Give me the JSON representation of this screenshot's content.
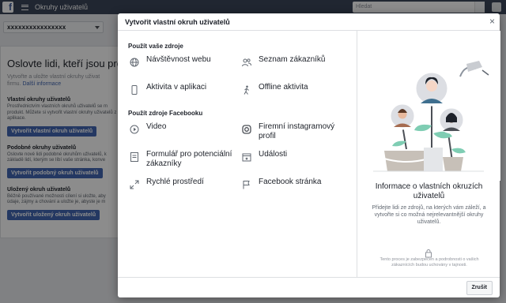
{
  "topbar": {
    "title": "Okruhy uživatelů",
    "search_placeholder": "Hledat"
  },
  "account": {
    "name": "xxxxxxxxxxxxxxxx"
  },
  "background": {
    "heading": "Oslovte lidi, kteří jsou pro vá",
    "intro_line1": "Vytvořte a uložte vlastní okruhy uživat",
    "intro_line2": "firmu.",
    "intro_link": "Další informace",
    "sections": [
      {
        "title": "Vlastní okruhy uživatelů",
        "lines": [
          "Prostřednictvím vlastních okruhů uživatelů se m",
          "produkt. Můžete si vytvořit vlastní okruhy uživatelů z",
          "aplikace."
        ],
        "button": "Vytvořit vlastní okruh uživatelů"
      },
      {
        "title": "Podobné okruhy uživatelů",
        "lines": [
          "Oslovte nové lidi podobné okruhům uživatelů, k",
          "základě lidí, kterým se líbí vaše stránka, konve"
        ],
        "button": "Vytvořit podobný okruh uživatelů"
      },
      {
        "title": "Uložený okruh uživatelů",
        "lines": [
          "Běžně používané možnosti cílení si uložte, aby",
          "údaje, zájmy a chování a uložte je, abyste je m"
        ],
        "button": "Vytvořit uložený okruh uživatelů"
      }
    ]
  },
  "modal": {
    "title": "Vytvořit vlastní okruh uživatelů",
    "close_label": "×",
    "group1_title": "Použít vaše zdroje",
    "group1": [
      {
        "label": "Návštěvnost webu",
        "icon": "globe-icon"
      },
      {
        "label": "Seznam zákazníků",
        "icon": "people-icon"
      },
      {
        "label": "Aktivita v aplikaci",
        "icon": "mobile-icon"
      },
      {
        "label": "Offline aktivita",
        "icon": "person-walking-icon"
      }
    ],
    "group2_title": "Použít zdroje Facebooku",
    "group2": [
      {
        "label": "Video",
        "icon": "play-icon"
      },
      {
        "label": "Firemní instagramový profil",
        "icon": "instagram-icon"
      },
      {
        "label": "Formulář pro potenciální zákazníky",
        "icon": "form-icon"
      },
      {
        "label": "Události",
        "icon": "calendar-icon"
      },
      {
        "label": "Rychlé prostředí",
        "icon": "expand-icon"
      },
      {
        "label": "Facebook stránka",
        "icon": "flag-icon"
      }
    ],
    "info_title": "Informace o vlastních okruzích uživatelů",
    "info_text": "Přidejte lidi ze zdrojů, na kterých vám záleží, a vytvořte si co možná nejrelevantnější okruhy uživatelů.",
    "secure_text": "Tento proces je zabezpečen a podrobnosti o vašich zákaznících budou uchovány v tajnosti.",
    "done_label": "Zrušit"
  }
}
